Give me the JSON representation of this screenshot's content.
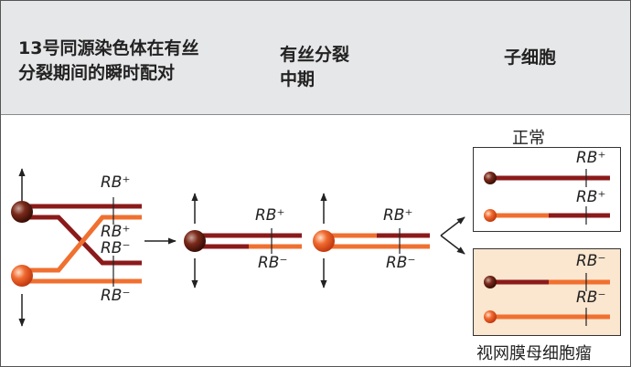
{
  "header": {
    "col1_line1": "13号同源染色体在有丝",
    "col1_line2": "分裂期间的瞬时配对",
    "col2_line1": "有丝分裂",
    "col2_line2": "中期",
    "col3": "子细胞"
  },
  "labels": {
    "rb_plus": "RB⁺",
    "rb_minus": "RB⁻"
  },
  "captions": {
    "normal": "正常",
    "retinoblastoma": "视网膜母细胞瘤"
  },
  "colors": {
    "dark_red": "#8b1a1a",
    "orange": "#f07030",
    "box_normal_bg": "#ffffff",
    "box_tumor_bg": "#fbe6cf",
    "header_bg": "#e6e7e8"
  }
}
